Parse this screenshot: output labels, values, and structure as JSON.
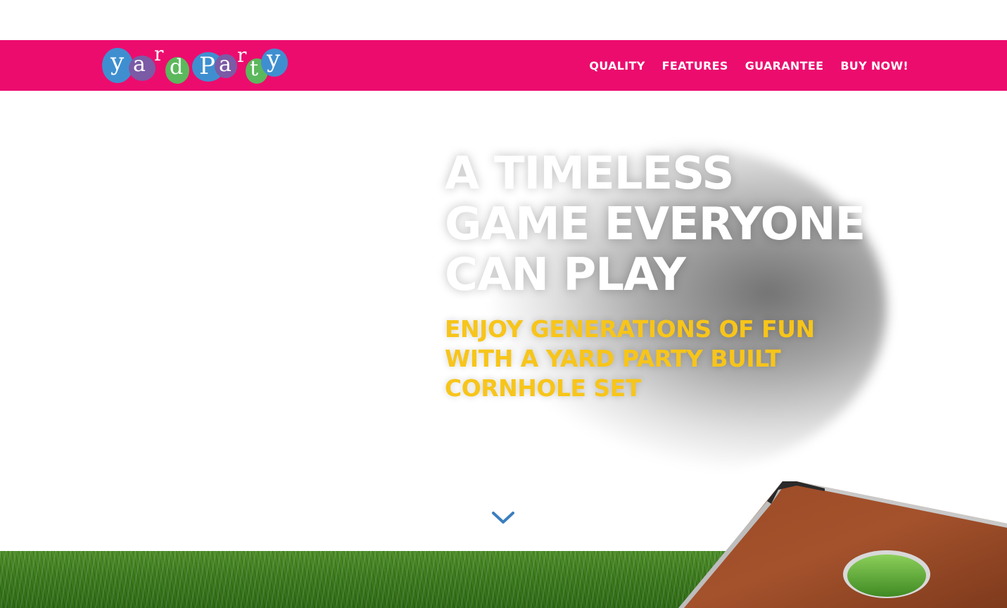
{
  "brand": {
    "logo_text": "yardParty",
    "logo_letters": [
      "y",
      "a",
      "r",
      "d",
      "P",
      "a",
      "r",
      "t",
      "y"
    ]
  },
  "nav": {
    "items": [
      {
        "label": "QUALITY"
      },
      {
        "label": "FEATURES"
      },
      {
        "label": "GUARANTEE"
      },
      {
        "label": "BUY NOW!"
      }
    ]
  },
  "hero": {
    "headline_lines": [
      "A TIMELESS",
      "GAME EVERYONE",
      "CAN PLAY"
    ],
    "subhead_lines": [
      "ENJOY GENERATIONS OF FUN",
      "WITH A YARD PARTY BUILT",
      "CORNHOLE SET"
    ],
    "scroll_icon": "chevron-down-icon"
  },
  "colors": {
    "header_bg": "#ec0c6e",
    "headline": "#ffffff",
    "subhead": "#f7c51a",
    "scroll_arrow": "#3a7fbf",
    "logo_blue": "#3f8fd0",
    "logo_purple": "#7b5aa6",
    "logo_green": "#5cb85c"
  }
}
